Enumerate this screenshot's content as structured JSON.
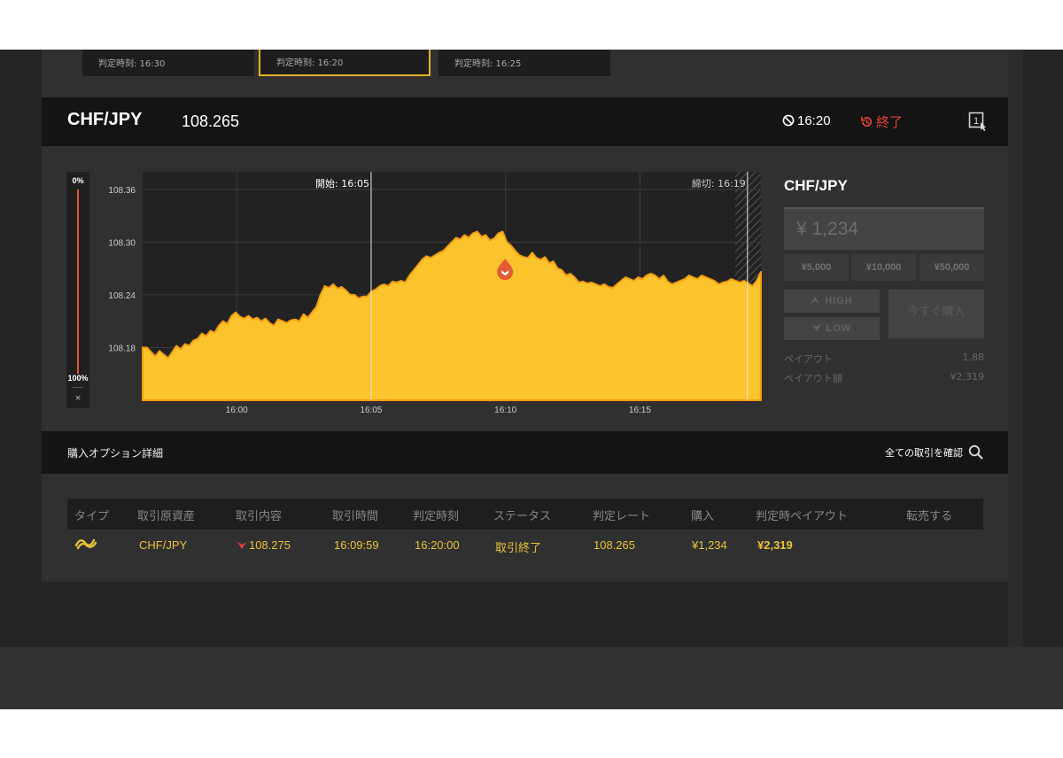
{
  "tabs": [
    {
      "label": "判定時刻: 16:30",
      "active": false
    },
    {
      "label": "判定時刻: 16:20",
      "active": true
    },
    {
      "label": "判定時刻: 16:25",
      "active": false
    }
  ],
  "header": {
    "pair": "CHF/JPY",
    "rate": "108.265",
    "time": "16:20",
    "status": "終了"
  },
  "gauge": {
    "top_label": "0%",
    "bottom_label": "100%",
    "close": "×"
  },
  "chart_data": {
    "type": "area",
    "title": "",
    "xlabel": "",
    "ylabel": "",
    "ylim": [
      108.12,
      108.38
    ],
    "yticks": [
      "108.36",
      "108.30",
      "108.24",
      "108.18"
    ],
    "xticks": [
      "16:00",
      "16:05",
      "16:10",
      "16:15"
    ],
    "annotations": {
      "start_label": "開始: 16:05",
      "close_label": "締切: 16:19"
    },
    "entry_marker": {
      "time": "16:09:59",
      "rate": 108.275,
      "direction": "LOW"
    },
    "series": [
      {
        "values": [
          108.18,
          108.18,
          108.175,
          108.17,
          108.176,
          108.172,
          108.168,
          108.175,
          108.182,
          108.178,
          108.184,
          108.182,
          108.188,
          108.19,
          108.196,
          108.193,
          108.199,
          108.197,
          108.205,
          108.21,
          108.207,
          108.216,
          108.22,
          108.215,
          108.213,
          108.216,
          108.212,
          108.214,
          108.21,
          108.213,
          108.208,
          108.205,
          108.212,
          108.21,
          108.208,
          108.211,
          108.212,
          108.21,
          108.218,
          108.214,
          108.22,
          108.226,
          108.24,
          108.25,
          108.248,
          108.252,
          108.247,
          108.249,
          108.245,
          108.24,
          108.24,
          108.236,
          108.238,
          108.238,
          108.244,
          108.246,
          108.25,
          108.252,
          108.25,
          108.255,
          108.254,
          108.256,
          108.254,
          108.262,
          108.268,
          108.274,
          108.28,
          108.284,
          108.282,
          108.285,
          108.288,
          108.29,
          108.295,
          108.3,
          108.305,
          108.303,
          108.308,
          108.305,
          108.31,
          108.312,
          108.306,
          108.308,
          108.302,
          108.304,
          108.31,
          108.312,
          108.3,
          108.296,
          108.29,
          108.285,
          108.283,
          108.282,
          108.288,
          108.282,
          108.28,
          108.283,
          108.276,
          108.278,
          108.27,
          108.268,
          108.262,
          108.264,
          108.26,
          108.254,
          108.255,
          108.253,
          108.254,
          108.252,
          108.25,
          108.252,
          108.249,
          108.248,
          108.252,
          108.256,
          108.26,
          108.258,
          108.256,
          108.26,
          108.258,
          108.262,
          108.264,
          108.262,
          108.258,
          108.262,
          108.255,
          108.252,
          108.254,
          108.256,
          108.258,
          108.262,
          108.26,
          108.258,
          108.262,
          108.26,
          108.258,
          108.256,
          108.252,
          108.254,
          108.255,
          108.258,
          108.256,
          108.254,
          108.256,
          108.253,
          108.25,
          108.256,
          108.266
        ]
      }
    ]
  },
  "side": {
    "pair": "CHF/JPY",
    "amount": "¥ 1,234",
    "presets": [
      "¥5,000",
      "¥10,000",
      "¥50,000"
    ],
    "high_label": "HIGH",
    "low_label": "LOW",
    "buy_now_label": "今すぐ購入",
    "payout_label": "ペイアウト",
    "payout_value": "1.88",
    "payout_amount_label": "ペイアウト額",
    "payout_amount_value": "¥2,319"
  },
  "detail": {
    "title": "購入オプション詳細",
    "all_trades_link": "全ての取引を確認"
  },
  "table": {
    "headers": [
      "タイプ",
      "取引原資産",
      "取引内容",
      "取引時間",
      "判定時刻",
      "ステータス",
      "判定レート",
      "購入",
      "判定時ペイアウト",
      "転売する"
    ],
    "row": {
      "asset": "CHF/JPY",
      "content": "108.275",
      "trade_time": "16:09:59",
      "expiry": "16:20:00",
      "status": "取引終了",
      "close_rate": "108.265",
      "purchase": "¥1,234",
      "payout": "¥2,319",
      "resell": ""
    }
  },
  "colors": {
    "accent": "#e6b323",
    "area_fill": "#fcc42c",
    "negative": "#e3423b",
    "panel": "#303030",
    "header_bar": "#141414"
  }
}
